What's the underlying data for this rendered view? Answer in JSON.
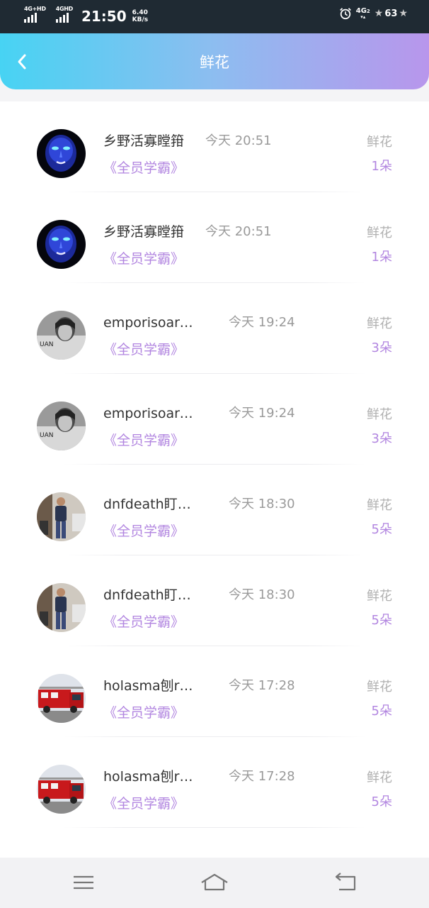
{
  "status_bar": {
    "network_1": "4G+HD",
    "network_2": "4GHD",
    "time": "21:50",
    "speed_value": "6.40",
    "speed_unit": "KB/s",
    "network_right": "4G",
    "network_right_sub": "2",
    "battery": "63"
  },
  "header": {
    "title": "鲜花",
    "back_icon": "chevron-left-icon"
  },
  "list": {
    "items": [
      {
        "name": "乡野活寡瞠箝",
        "time": "今天 20:51",
        "course": "《全员学霸》",
        "flower_label": "鲜花",
        "flower_count": "1朵",
        "avatar": "blue-face-avatar"
      },
      {
        "name": "乡野活寡瞠箝",
        "time": "今天 20:51",
        "course": "《全员学霸》",
        "flower_label": "鲜花",
        "flower_count": "1朵",
        "avatar": "blue-face-avatar"
      },
      {
        "name": "emporisoarma...",
        "time": "今天 19:24",
        "course": "《全员学霸》",
        "flower_label": "鲜花",
        "flower_count": "3朵",
        "avatar": "bw-portrait-avatar"
      },
      {
        "name": "emporisoarma...",
        "time": "今天 19:24",
        "course": "《全员学霸》",
        "flower_label": "鲜花",
        "flower_count": "3朵",
        "avatar": "bw-portrait-avatar"
      },
      {
        "name": "dnfdeath盯/kni...",
        "time": "今天 18:30",
        "course": "《全员学霸》",
        "flower_label": "鲜花",
        "flower_count": "5朵",
        "avatar": "street-person-avatar"
      },
      {
        "name": "dnfdeath盯/kni...",
        "time": "今天 18:30",
        "course": "《全员学霸》",
        "flower_label": "鲜花",
        "flower_count": "5朵",
        "avatar": "street-person-avatar"
      },
      {
        "name": "holasma刨rt邃...",
        "time": "今天 17:28",
        "course": "《全员学霸》",
        "flower_label": "鲜花",
        "flower_count": "5朵",
        "avatar": "fire-truck-avatar"
      },
      {
        "name": "holasma刨rt邃...",
        "time": "今天 17:28",
        "course": "《全员学霸》",
        "flower_label": "鲜花",
        "flower_count": "5朵",
        "avatar": "fire-truck-avatar"
      }
    ]
  },
  "nav_bar": {
    "menu_icon": "menu-icon",
    "home_icon": "home-icon",
    "back_icon": "back-icon"
  },
  "colors": {
    "header_gradient_start": "#47d3f3",
    "header_gradient_end": "#b896ec",
    "accent_purple": "#b286e0",
    "status_bar_bg": "#1f2a33"
  }
}
